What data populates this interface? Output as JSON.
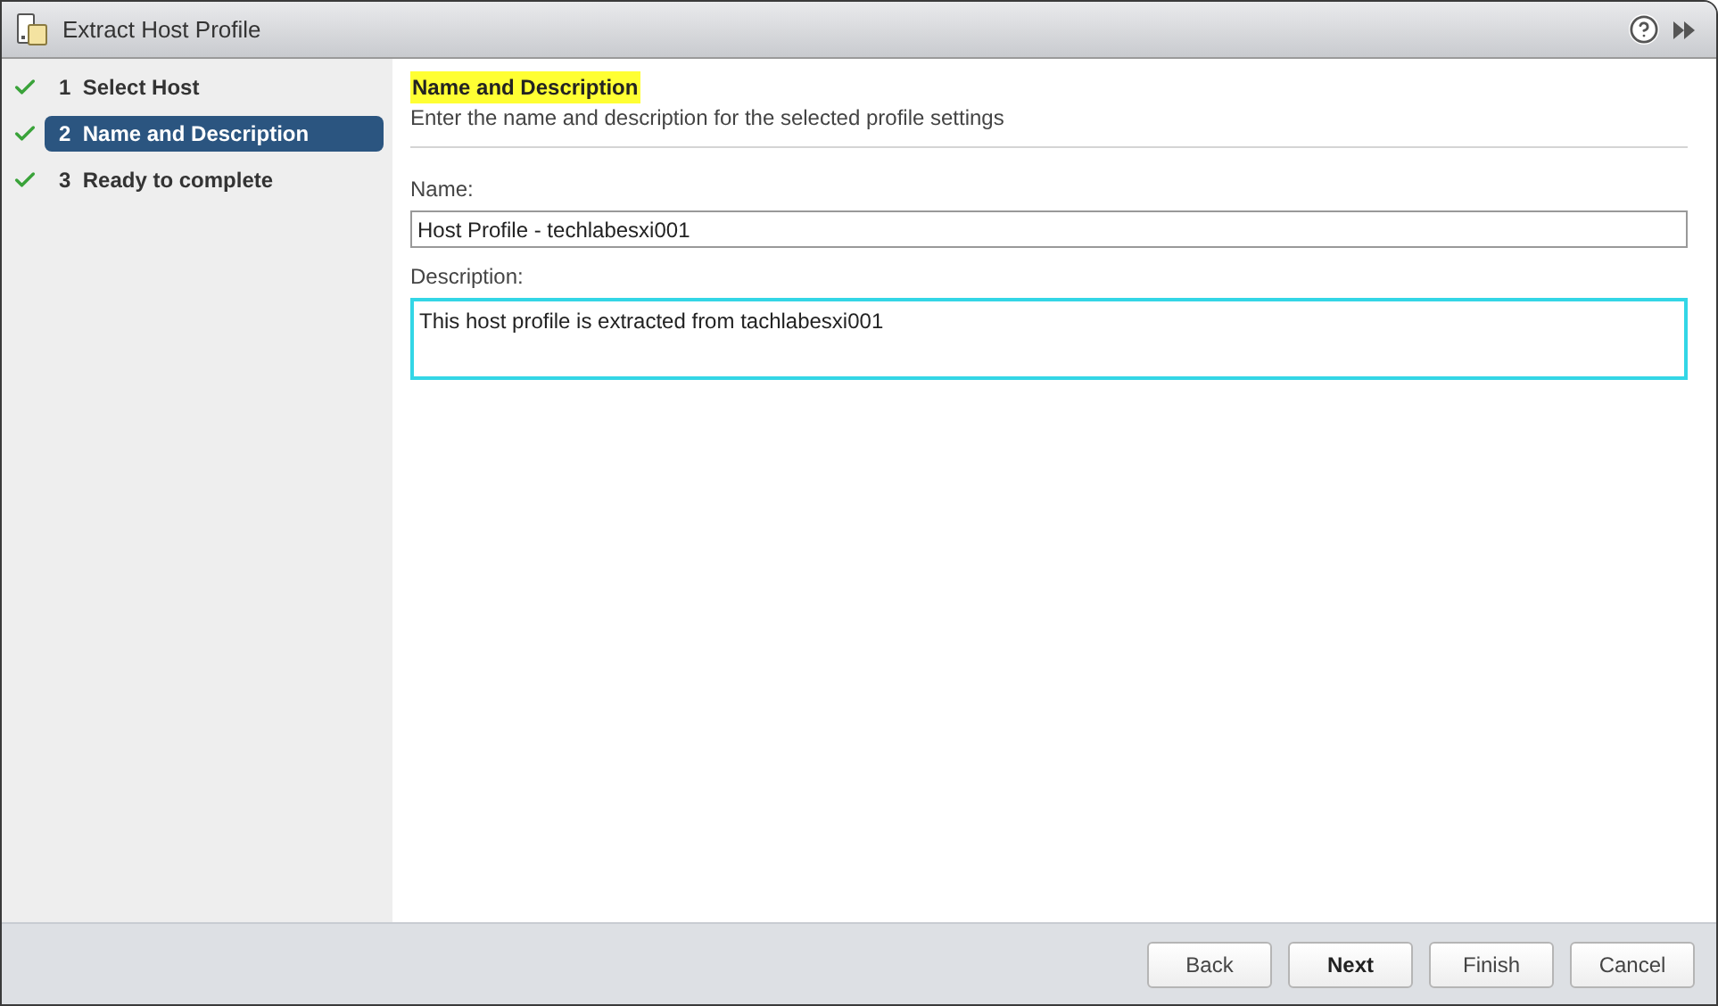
{
  "window": {
    "title": "Extract Host Profile"
  },
  "steps": [
    {
      "number": "1",
      "label": "Select Host",
      "completed": true,
      "selected": false
    },
    {
      "number": "2",
      "label": "Name and Description",
      "completed": true,
      "selected": true
    },
    {
      "number": "3",
      "label": "Ready to complete",
      "completed": true,
      "selected": false
    }
  ],
  "page": {
    "heading": "Name and Description",
    "subtitle": "Enter the name and description for the selected profile settings",
    "fields": [
      {
        "kind": "input",
        "label": "Name:",
        "value": "Host Profile - techlabesxi001",
        "focused": false
      },
      {
        "kind": "textarea",
        "label": "Description:",
        "value": "This host profile is extracted from tachlabesxi001",
        "focused": true
      }
    ]
  },
  "buttons": [
    {
      "label": "Back",
      "default": false
    },
    {
      "label": "Next",
      "default": true
    },
    {
      "label": "Finish",
      "default": false
    },
    {
      "label": "Cancel",
      "default": false
    }
  ]
}
